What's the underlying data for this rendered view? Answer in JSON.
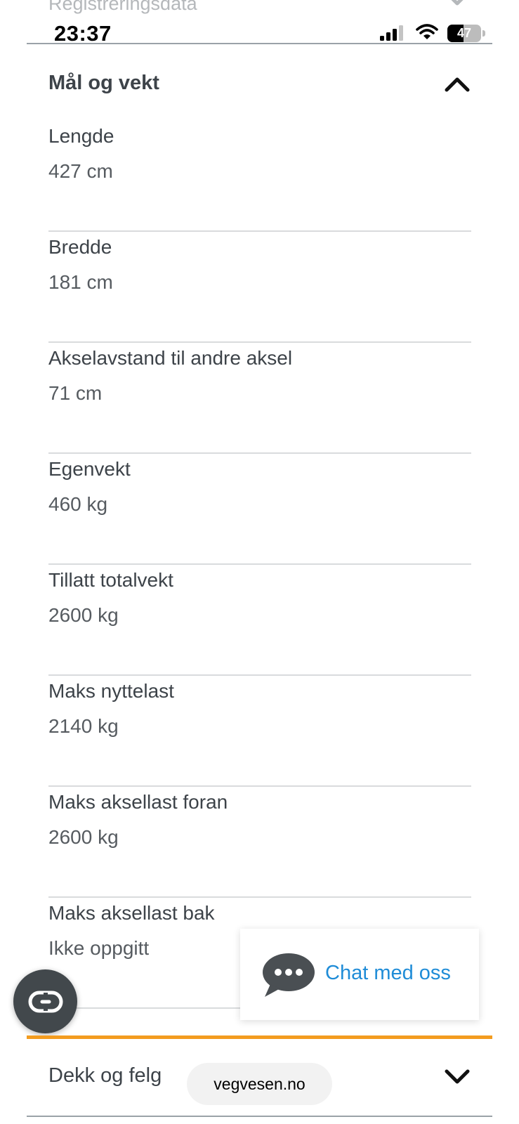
{
  "previous_section": {
    "title": "Registreringsdata"
  },
  "status_bar": {
    "time": "23:37",
    "battery_level": "47"
  },
  "section": {
    "title": "Mål og vekt",
    "fields": [
      {
        "label": "Lengde",
        "value": "427 cm"
      },
      {
        "label": "Bredde",
        "value": "181 cm"
      },
      {
        "label": "Akselavstand til andre aksel",
        "value": "71 cm"
      },
      {
        "label": "Egenvekt",
        "value": "460 kg"
      },
      {
        "label": "Tillatt totalvekt",
        "value": "2600 kg"
      },
      {
        "label": "Maks nyttelast",
        "value": "2140 kg"
      },
      {
        "label": "Maks aksellast foran",
        "value": "2600 kg"
      },
      {
        "label": "Maks aksellast bak",
        "value": "Ikke oppgitt"
      }
    ]
  },
  "chat": {
    "label": "Chat med oss"
  },
  "next_section": {
    "title": "Dekk og felg"
  },
  "browser": {
    "url": "vegvesen.no"
  },
  "colors": {
    "accent_orange": "#f39c1f",
    "link_blue": "#1f8cd7",
    "text_dark": "#3d4349"
  },
  "icons": {
    "section_toggle_open": "chevron-up-icon",
    "section_toggle_closed": "chevron-down-icon",
    "chat": "chat-bubble-icon",
    "accessibility": "read-aloud-icon"
  }
}
